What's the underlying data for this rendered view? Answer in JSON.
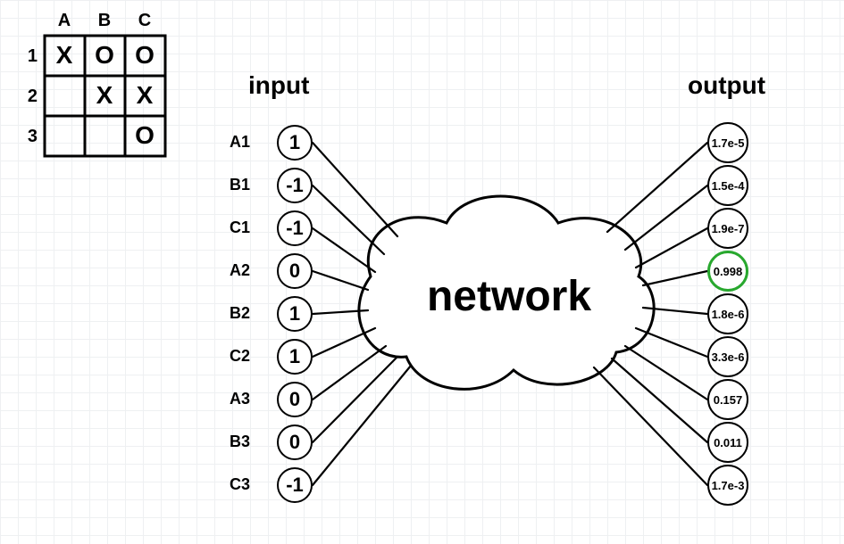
{
  "board": {
    "cols": [
      "A",
      "B",
      "C"
    ],
    "rows": [
      "1",
      "2",
      "3"
    ],
    "cells": {
      "A1": "X",
      "B1": "O",
      "C1": "O",
      "A2": "",
      "B2": "X",
      "C2": "X",
      "A3": "",
      "B3": "",
      "C3": "O"
    }
  },
  "headings": {
    "input": "input",
    "output": "output",
    "network": "network"
  },
  "inputs": [
    {
      "label": "A1",
      "value": "1"
    },
    {
      "label": "B1",
      "value": "-1"
    },
    {
      "label": "C1",
      "value": "-1"
    },
    {
      "label": "A2",
      "value": "0"
    },
    {
      "label": "B2",
      "value": "1"
    },
    {
      "label": "C2",
      "value": "1"
    },
    {
      "label": "A3",
      "value": "0"
    },
    {
      "label": "B3",
      "value": "0"
    },
    {
      "label": "C3",
      "value": "-1"
    }
  ],
  "outputs": [
    {
      "value": "1.7e-5",
      "highlight": false
    },
    {
      "value": "1.5e-4",
      "highlight": false
    },
    {
      "value": "1.9e-7",
      "highlight": false
    },
    {
      "value": "0.998",
      "highlight": true
    },
    {
      "value": "1.8e-6",
      "highlight": false
    },
    {
      "value": "3.3e-6",
      "highlight": false
    },
    {
      "value": "0.157",
      "highlight": false
    },
    {
      "value": "0.011",
      "highlight": false
    },
    {
      "value": "1.7e-3",
      "highlight": false
    }
  ],
  "chart_data": {
    "type": "table",
    "title": "Tic-tac-toe board encoded as network input/output",
    "board_encoding": {
      "X": 1,
      "O": -1,
      "empty": 0
    },
    "board_state": [
      [
        "X",
        "O",
        "O"
      ],
      [
        "",
        "X",
        "X"
      ],
      [
        "",
        "",
        "O"
      ]
    ],
    "input_vector_order": [
      "A1",
      "B1",
      "C1",
      "A2",
      "B2",
      "C2",
      "A3",
      "B3",
      "C3"
    ],
    "input_vector": [
      1,
      -1,
      -1,
      0,
      1,
      1,
      0,
      0,
      -1
    ],
    "output_vector": [
      1.7e-05,
      0.00015,
      1.9e-07,
      0.998,
      1.8e-06,
      3.3e-06,
      0.157,
      0.011,
      0.0017
    ],
    "highlighted_output_index": 3
  }
}
